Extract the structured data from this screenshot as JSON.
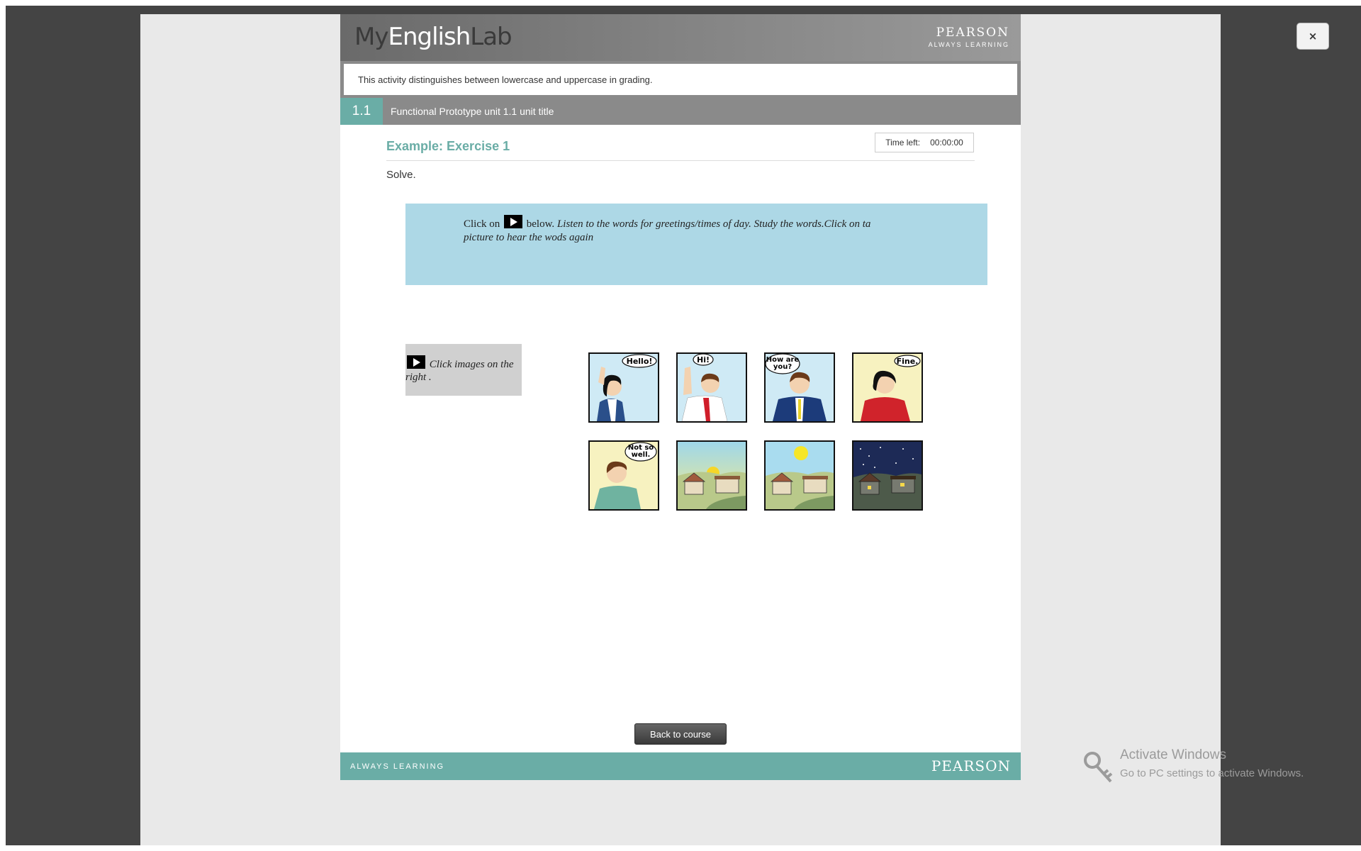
{
  "header": {
    "logo_my": "My",
    "logo_english": "English",
    "logo_lab": "Lab",
    "brand": "PEARSON",
    "brand_tagline": "ALWAYS LEARNING"
  },
  "close_label": "×",
  "notice": "This activity distinguishes between lowercase and uppercase in grading.",
  "unit": {
    "number": "1.1",
    "title": "Functional Prototype unit 1.1 unit title"
  },
  "exercise": {
    "title": "Example: Exercise 1",
    "timer_label": "Time left:",
    "timer_value": "00:00:00",
    "prompt": "Solve."
  },
  "instructions": {
    "click_on": "Click on",
    "below": "below.",
    "rest": "Listen to the words for greetings/times of day. Study the words.Click on ta picture to hear the wods again"
  },
  "side_prompt": "Click images on the right .",
  "tiles": [
    {
      "name": "hello",
      "caption": "Hello!"
    },
    {
      "name": "hi",
      "caption": "Hi!"
    },
    {
      "name": "how-are-you",
      "caption": "How are you?"
    },
    {
      "name": "fine",
      "caption": "Fine."
    },
    {
      "name": "not-so-well",
      "caption": "Not so well."
    },
    {
      "name": "morning",
      "caption": ""
    },
    {
      "name": "afternoon",
      "caption": ""
    },
    {
      "name": "night",
      "caption": ""
    }
  ],
  "back_button": "Back to course",
  "footer": {
    "always": "ALWAYS LEARNING",
    "brand": "PEARSON"
  },
  "windows_watermark": {
    "line1": "Activate Windows",
    "line2": "Go to PC settings to activate Windows."
  },
  "colors": {
    "teal": "#6aada6",
    "instruction_bg": "#add8e6",
    "overlay": "#444444"
  }
}
